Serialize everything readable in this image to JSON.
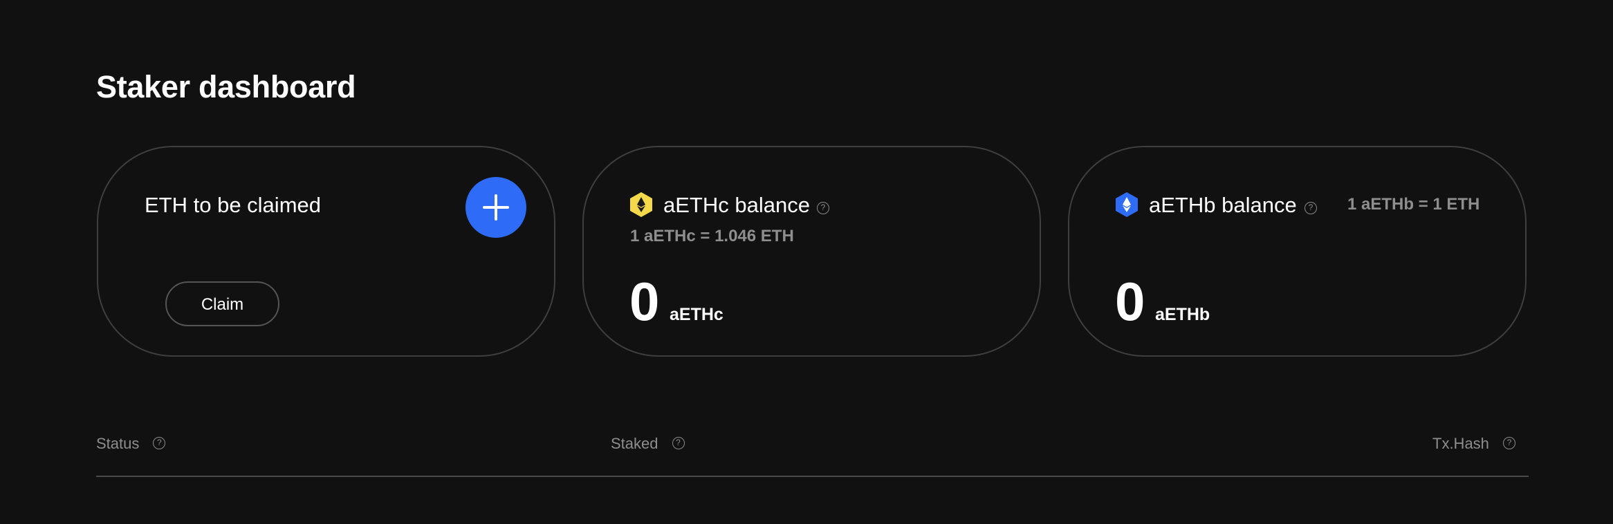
{
  "page": {
    "title": "Staker dashboard"
  },
  "cards": {
    "claim": {
      "title": "ETH to be claimed",
      "claim_label": "Claim",
      "add_icon": "plus-icon"
    },
    "aethc": {
      "title": "aETHc balance",
      "help": "?",
      "rate": "1 aETHc = 1.046 ETH",
      "amount": "0",
      "unit": "aETHc",
      "icon": "aethc-token-icon",
      "icon_color": "#f5d94a"
    },
    "aethb": {
      "title": "aETHb balance",
      "help": "?",
      "rate": "1 aETHb = 1 ETH",
      "amount": "0",
      "unit": "aETHb",
      "icon": "aethb-token-icon",
      "icon_color": "#2e6bf6"
    }
  },
  "table": {
    "columns": [
      {
        "label": "Status",
        "help": "?"
      },
      {
        "label": "Staked",
        "help": "?"
      },
      {
        "label": "Tx.Hash",
        "help": "?"
      }
    ]
  },
  "colors": {
    "background": "#111111",
    "accent": "#2e6bf6",
    "border": "#3f3f3f",
    "muted_text": "#8e8e8e"
  }
}
